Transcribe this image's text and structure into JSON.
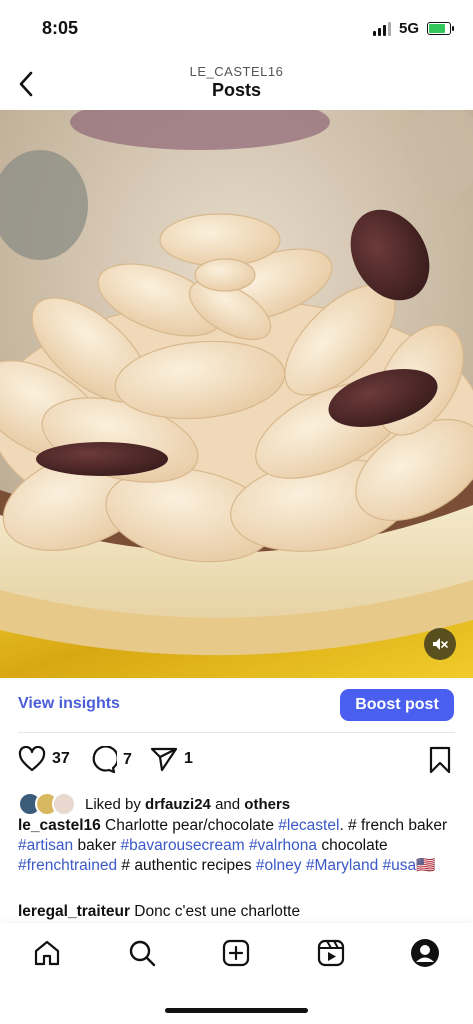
{
  "status": {
    "time": "8:05",
    "network": "5G",
    "battery_level": 0.8
  },
  "header": {
    "account": "LE_CASTEL16",
    "title": "Posts"
  },
  "post": {
    "insights_label": "View insights",
    "boost_label": "Boost post",
    "likes_count": "37",
    "comments_count": "7",
    "shares_count": "1",
    "liked_by_prefix": "Liked by ",
    "liked_by_user": "drfauzi24",
    "liked_by_and": " and ",
    "liked_by_others": "others",
    "caption_user": "le_castel16",
    "caption_1": " Charlotte pear/chocolate ",
    "tag_lecastel": "#lecastel",
    "caption_2": ". # french baker ",
    "tag_artisan": "#artisan",
    "caption_3": " baker ",
    "tag_bavarousecream": "#bavarousecream",
    "tag_valrhona": "#valrhona",
    "caption_4": " chocolate ",
    "tag_frenchtrained": "#frenchtrained",
    "caption_5": " # authentic recipes ",
    "tag_olney": "#olney",
    "tag_maryland": "#Maryland",
    "tag_usa": "#usa",
    "flag": "🇺🇸",
    "comment_user": "leregal_traiteur",
    "comment_text": " Donc c'est une charlotte"
  },
  "icons": [
    "back-icon",
    "mute-icon",
    "heart-icon",
    "comment-icon",
    "share-icon",
    "bookmark-icon",
    "home-icon",
    "search-icon",
    "create-icon",
    "reels-icon",
    "profile-icon"
  ],
  "colors": {
    "accent": "#4a5ef0",
    "link": "#3b59c8"
  }
}
